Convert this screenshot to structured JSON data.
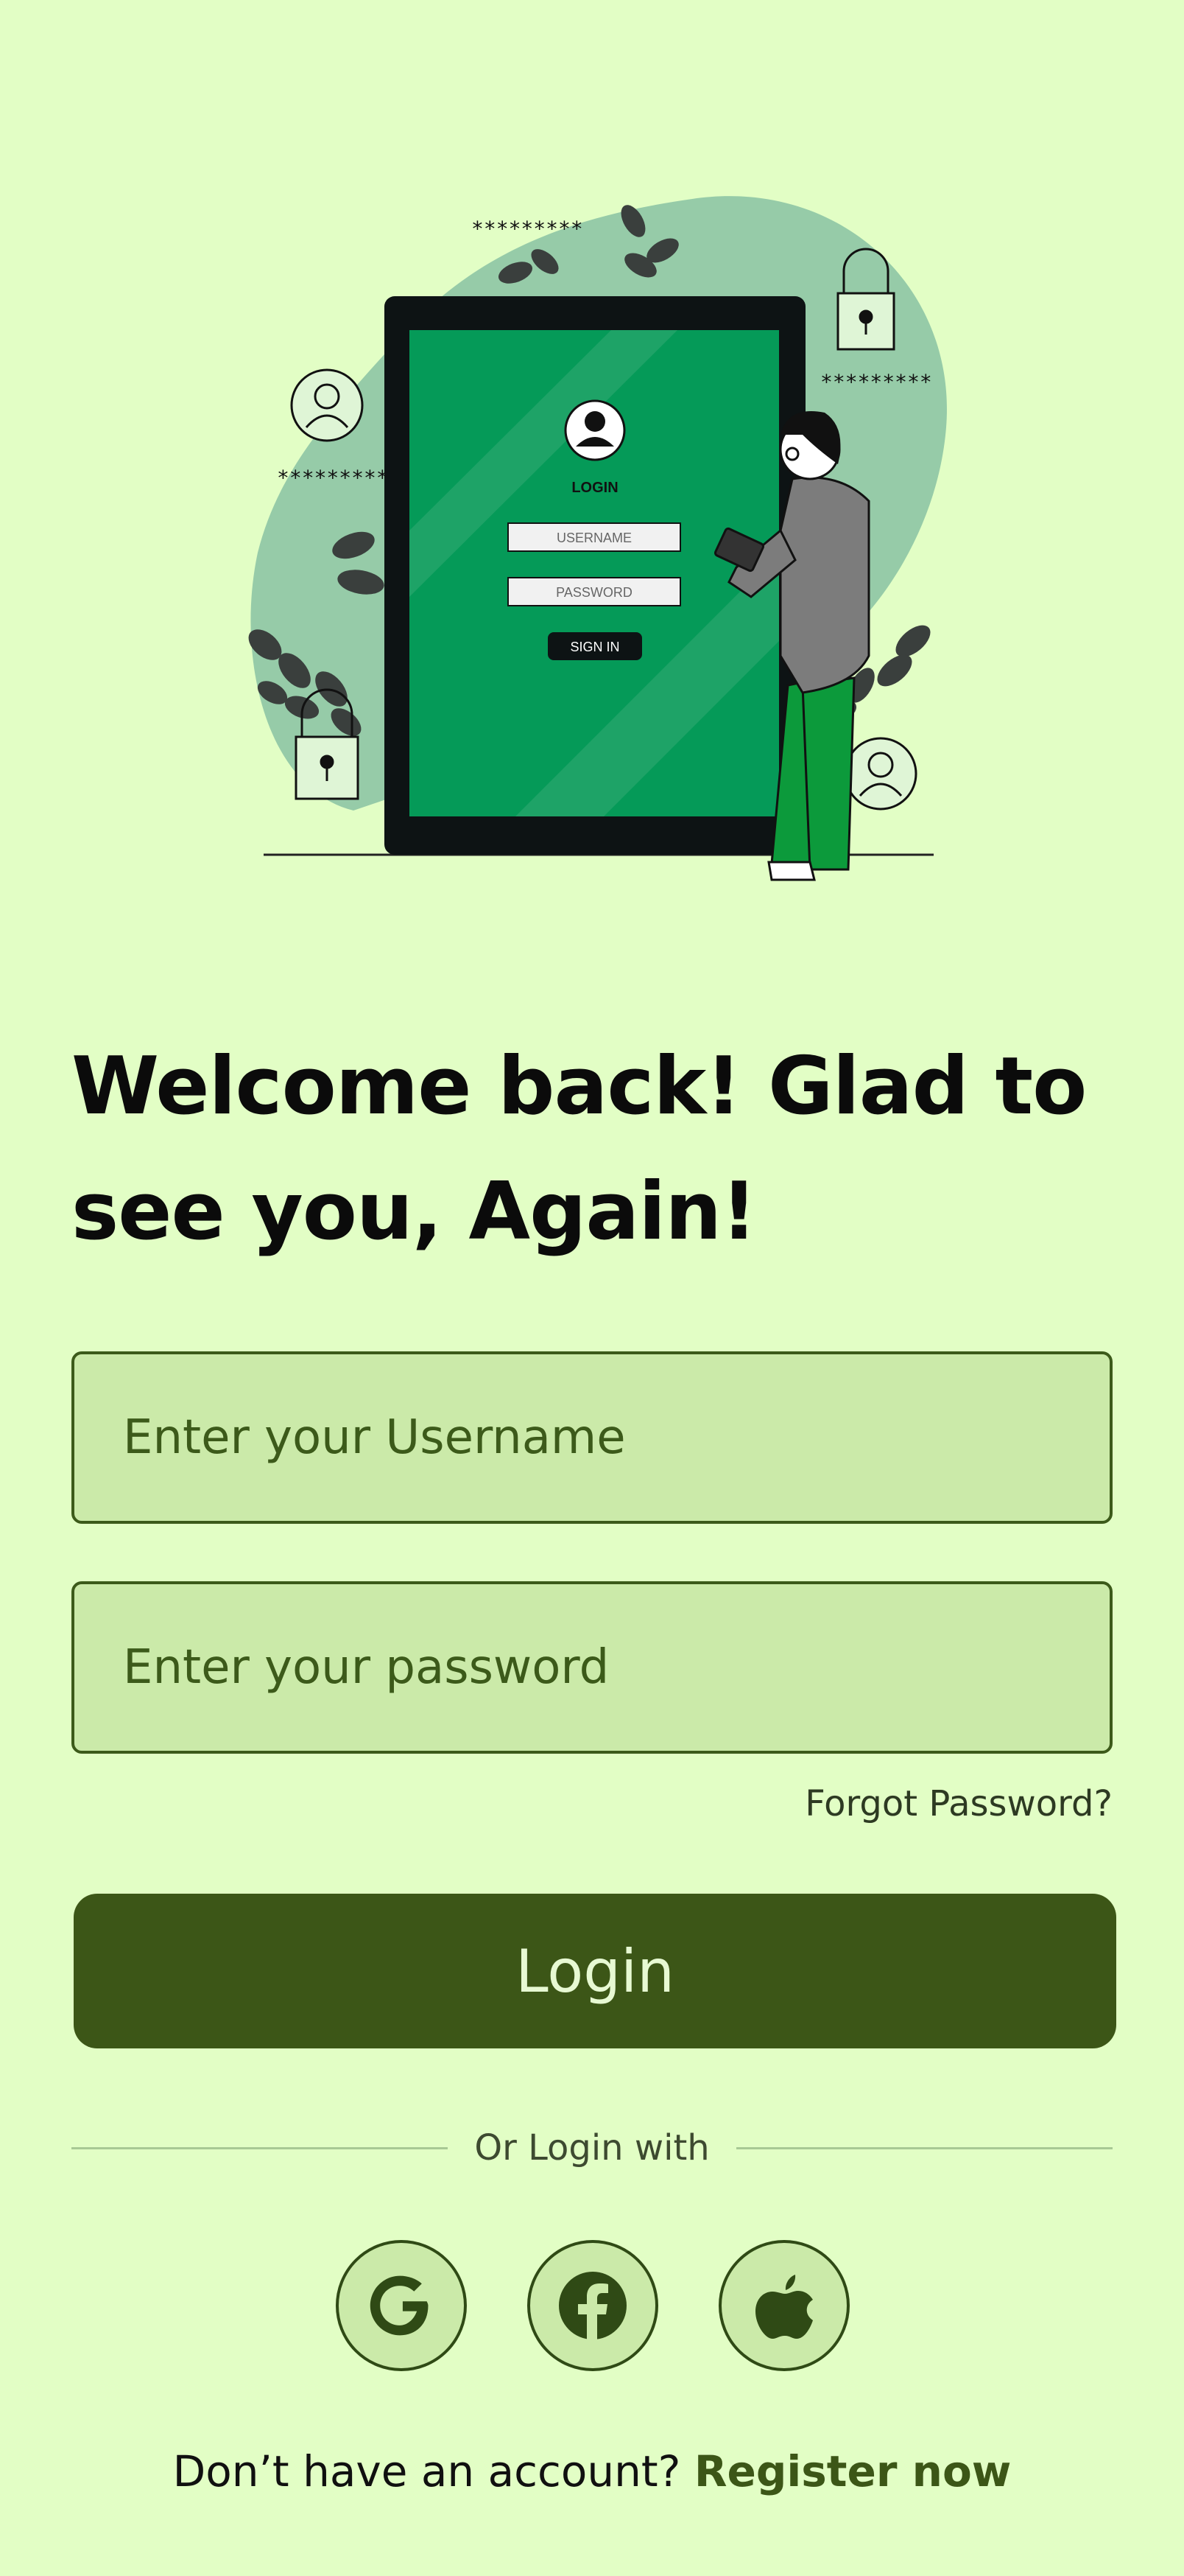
{
  "illustration": {
    "screen_title": "LOGIN",
    "username_label": "USERNAME",
    "password_label": "PASSWORD",
    "signin_label": "SIGN IN",
    "masked_text": "*********"
  },
  "title": {
    "line1": "Welcome back! Glad to",
    "line2": "see you, Again!"
  },
  "username": {
    "placeholder": "Enter your Username",
    "value": ""
  },
  "password": {
    "placeholder": "Enter your password",
    "value": ""
  },
  "forgot_label": "Forgot Password?",
  "login_label": "Login",
  "divider_label": "Or Login with",
  "social": [
    {
      "name": "google",
      "icon": "google-icon"
    },
    {
      "name": "facebook",
      "icon": "facebook-icon"
    },
    {
      "name": "apple",
      "icon": "apple-icon"
    }
  ],
  "footer": {
    "prompt": "Don’t have an account?",
    "register_label": "Register now"
  },
  "colors": {
    "background": "#e2fec5",
    "accent": "#3c5617",
    "field_bg": "#cbeaa9",
    "illustration_green": "#059a58"
  }
}
